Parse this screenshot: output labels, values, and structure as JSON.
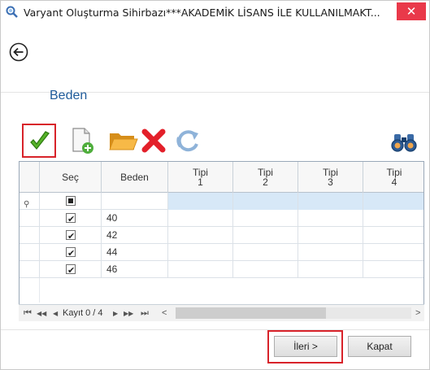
{
  "window": {
    "title": "Varyant Oluşturma Sihirbazı***AKADEMİK LİSANS İLE KULLANILMAKT...",
    "close_label": "✕"
  },
  "header": {
    "back_icon": "back-circle-arrow-icon",
    "page_title": "Beden"
  },
  "toolbar": {
    "items": [
      {
        "icon": "green-checkmark-icon",
        "highlighted": true
      },
      {
        "icon": "new-document-add-icon"
      },
      {
        "icon": "open-folder-icon"
      },
      {
        "icon": "red-x-delete-icon"
      },
      {
        "icon": "refresh-icon"
      },
      {
        "icon": "binoculars-search-icon"
      }
    ]
  },
  "grid": {
    "columns": [
      {
        "line1": "",
        "line2": ""
      },
      {
        "line1": "Seç",
        "line2": ""
      },
      {
        "line1": "Beden",
        "line2": ""
      },
      {
        "line1": "Tipi",
        "line2": "1"
      },
      {
        "line1": "Tipi",
        "line2": "2"
      },
      {
        "line1": "Tipi",
        "line2": "3"
      },
      {
        "line1": "Tipi",
        "line2": "4"
      }
    ],
    "new_row_marker": "⚲",
    "rows": [
      {
        "selected": true,
        "beden": "40"
      },
      {
        "selected": true,
        "beden": "42"
      },
      {
        "selected": true,
        "beden": "44"
      },
      {
        "selected": true,
        "beden": "46"
      }
    ]
  },
  "navigator": {
    "first": "⏮",
    "prev_page": "◀◀",
    "prev": "◀",
    "record_text": "Kayıt 0 / 4",
    "next": "▶",
    "next_page": "▶▶",
    "last": "⏭",
    "scroll_left": "<",
    "scroll_right": ">"
  },
  "footer": {
    "next_label": "İleri >",
    "close_label": "Kapat"
  },
  "colors": {
    "accent_title": "#1f5b9a",
    "highlight": "#d8232a",
    "close_red": "#e9394a",
    "row_blue": "#d7e8f7"
  }
}
